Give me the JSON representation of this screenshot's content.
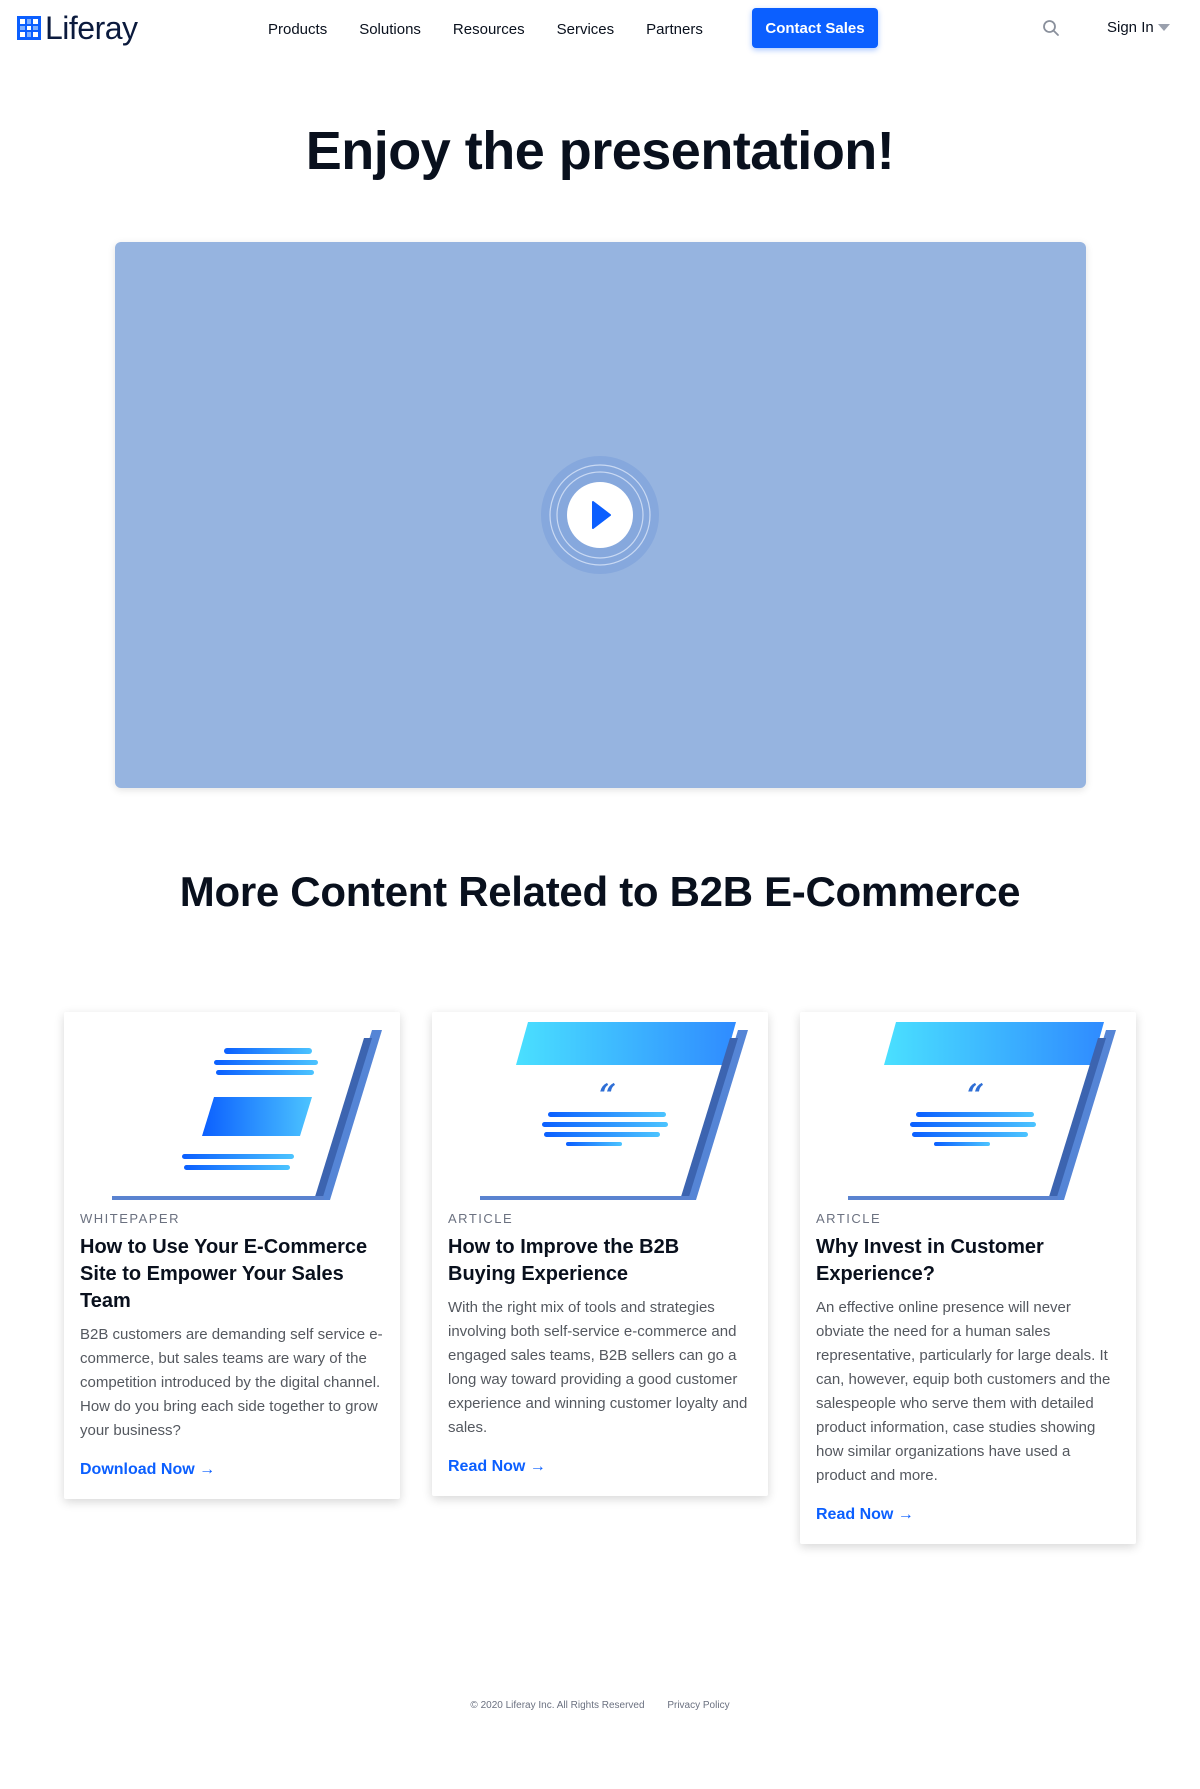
{
  "header": {
    "logo_text": "Liferay",
    "nav": [
      "Products",
      "Solutions",
      "Resources",
      "Services",
      "Partners"
    ],
    "cta_label": "Contact Sales",
    "search_icon": "search-icon",
    "signin_label": "Sign In"
  },
  "hero": {
    "title": "Enjoy the presentation!",
    "video_bg_color": "#96b4e0",
    "play_icon": "play-icon"
  },
  "related": {
    "title": "More Content Related to B2B E-Commerce",
    "cards": [
      {
        "type": "WHITEPAPER",
        "title": "How to Use Your E-Commerce Site to Empower Your Sales Team",
        "description": "B2B customers are demanding self service e-commerce, but sales teams are wary of the competition introduced by the digital channel.  How do you bring each side together to grow your business?",
        "link": "Download Now →",
        "illustration": "whitepaper-illustration"
      },
      {
        "type": "ARTICLE",
        "title": "How to Improve the B2B Buying Experience",
        "description": "With the right mix of tools and strategies involving both self-service e-commerce and engaged sales teams, B2B sellers can go a long way toward providing a good customer experience and winning customer loyalty and sales.",
        "link": "Read Now →",
        "illustration": "article-illustration"
      },
      {
        "type": "ARTICLE",
        "title": "Why Invest in Customer Experience?",
        "description": "An effective online presence will never obviate the need for a human sales representative, particularly for large deals. It can, however, equip both customers and the salespeople who serve them with detailed product information, case studies showing how similar organizations have used a product and more.",
        "link": "Read Now →",
        "illustration": "article-illustration"
      }
    ]
  },
  "footer": {
    "copyright": "© 2020 Liferay Inc. All Rights Reserved",
    "privacy": "Privacy Policy"
  },
  "colors": {
    "brand": "#0b5fff",
    "text": "#09101d",
    "muted": "#54585f"
  }
}
